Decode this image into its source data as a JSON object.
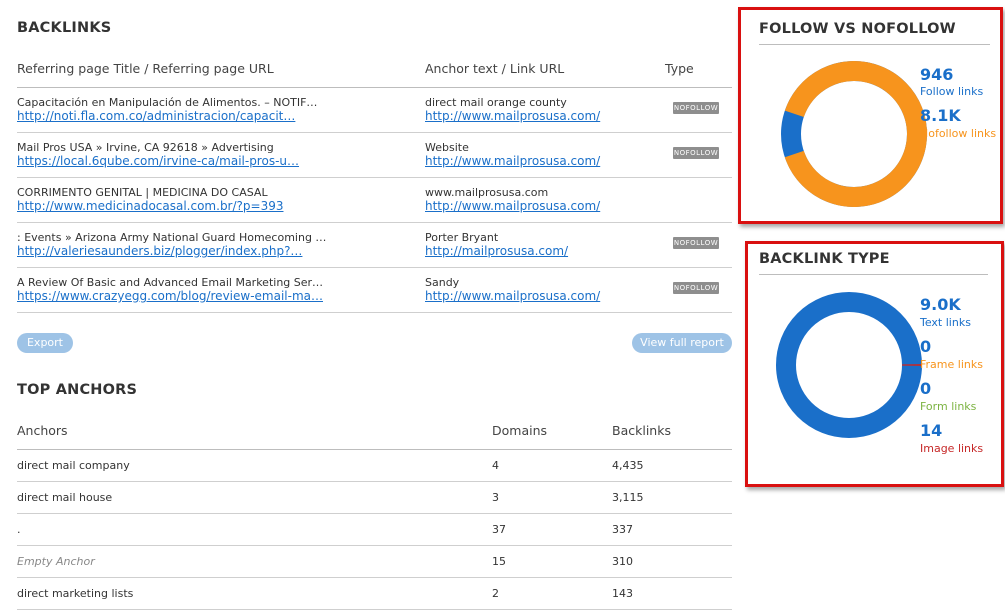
{
  "backlinks": {
    "title": "BACKLINKS",
    "columns": {
      "referring": "Referring page Title / Referring page URL",
      "anchor": "Anchor text / Link URL",
      "type": "Type"
    },
    "rows": [
      {
        "title": "Capacitación en Manipulación de Alimentos. – NOTIF…",
        "url": "http://noti.fla.com.co/administracion/capacit…",
        "anchor": "direct mail orange county",
        "link": "http://www.mailprosusa.com/",
        "type": "NOFOLLOW"
      },
      {
        "title": "Mail Pros USA » Irvine, CA 92618 » Advertising",
        "url": "https://local.6qube.com/irvine-ca/mail-pros-u…",
        "anchor": "Website",
        "link": "http://www.mailprosusa.com/",
        "type": "NOFOLLOW"
      },
      {
        "title": "CORRIMENTO GENITAL | MEDICINA DO CASAL",
        "url": "http://www.medicinadocasal.com.br/?p=393",
        "anchor": "www.mailprosusa.com",
        "link": "http://www.mailprosusa.com/",
        "type": ""
      },
      {
        "title": ": Events » Arizona Army National Guard Homecoming …",
        "url": "http://valeriesaunders.biz/plogger/index.php?…",
        "anchor": "Porter Bryant",
        "link": "http://mailprosusa.com/",
        "type": "NOFOLLOW"
      },
      {
        "title": "A Review Of Basic and Advanced Email Marketing Ser…",
        "url": "https://www.crazyegg.com/blog/review-email-ma…",
        "anchor": "Sandy",
        "link": "http://www.mailprosusa.com/",
        "type": "NOFOLLOW"
      }
    ],
    "export_label": "Export",
    "view_full_label": "View full report"
  },
  "top_anchors": {
    "title": "TOP ANCHORS",
    "columns": {
      "anchors": "Anchors",
      "domains": "Domains",
      "backlinks": "Backlinks"
    },
    "rows": [
      {
        "anchor": "direct mail company",
        "domains": "4",
        "backlinks": "4,435",
        "empty": false
      },
      {
        "anchor": "direct mail house",
        "domains": "3",
        "backlinks": "3,115",
        "empty": false
      },
      {
        "anchor": ".",
        "domains": "37",
        "backlinks": "337",
        "empty": false
      },
      {
        "anchor": "Empty Anchor",
        "domains": "15",
        "backlinks": "310",
        "empty": true
      },
      {
        "anchor": "direct marketing lists",
        "domains": "2",
        "backlinks": "143",
        "empty": false
      }
    ]
  },
  "follow_panel": {
    "title": "FOLLOW VS NOFOLLOW",
    "stats": [
      {
        "value": "946",
        "label": "Follow links",
        "color": "#1a6fc9",
        "share": 0.104
      },
      {
        "value": "8.1K",
        "label": "Nofollow links",
        "color": "#f7941d",
        "share": 0.896
      }
    ]
  },
  "type_panel": {
    "title": "BACKLINK TYPE",
    "stats": [
      {
        "value": "9.0K",
        "label": "Text links",
        "color": "#1a6fc9",
        "share": 0.9984
      },
      {
        "value": "0",
        "label": "Frame links",
        "color": "#f7941d",
        "share": 0
      },
      {
        "value": "0",
        "label": "Form links",
        "color": "#7cb342",
        "share": 0
      },
      {
        "value": "14",
        "label": "Image links",
        "color": "#c62828",
        "share": 0.0016
      }
    ]
  },
  "colors": {
    "accent": "#1a6fc9",
    "badge": "#8e8e8e",
    "button": "#9ec3e6",
    "highlight_border": "#d91010"
  }
}
